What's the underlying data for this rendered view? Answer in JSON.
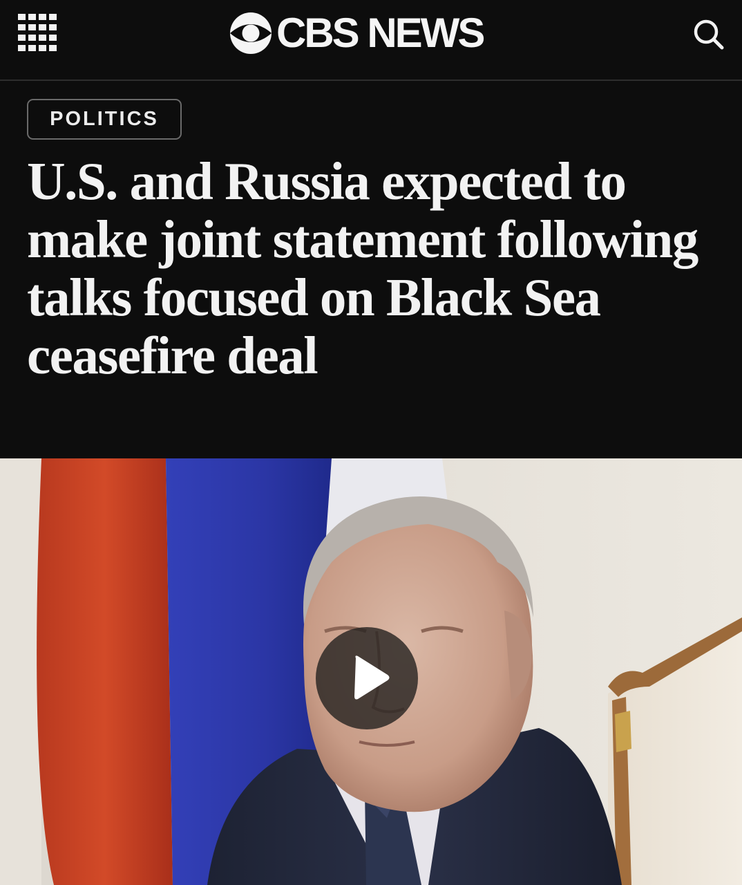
{
  "header": {
    "brand": "CBS NEWS",
    "menu_icon": "grid-menu-icon",
    "search_icon": "search-icon",
    "background": "#0d0d0d"
  },
  "article": {
    "category": "POLITICS",
    "headline": "U.S. and Russia expected to make joint statement following talks focused on Black Sea ceasefire deal"
  },
  "media": {
    "type": "video",
    "play_icon": "play-icon"
  }
}
